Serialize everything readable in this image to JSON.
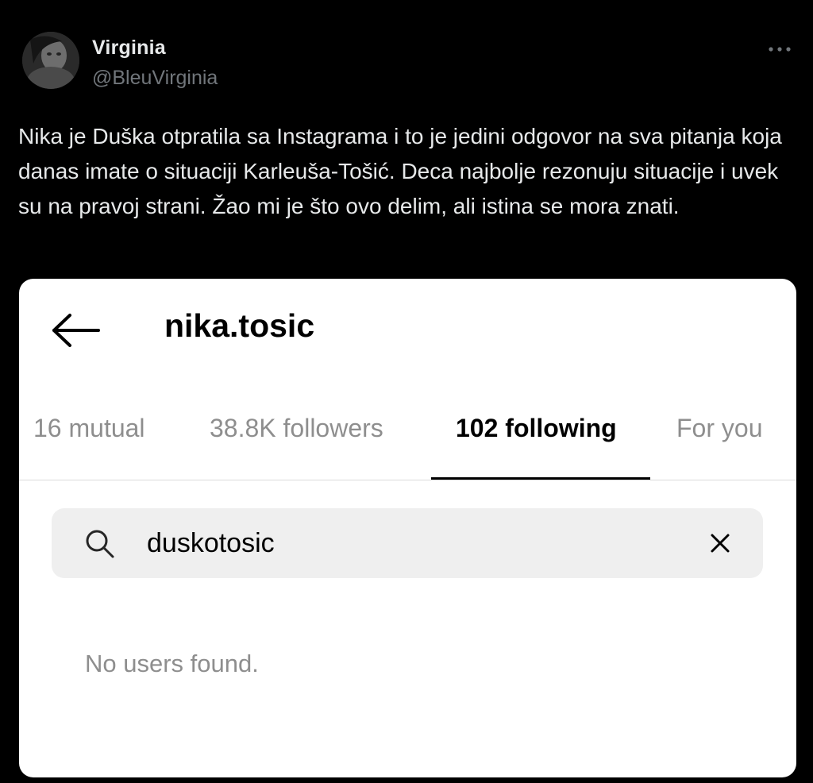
{
  "tweet": {
    "author": {
      "name": "Virginia",
      "handle": "@BleuVirginia"
    },
    "text": "Nika je Duška otpratila sa Instagrama i to je jedini odgovor na sva pitanja koja danas imate o situaciji Karleuša-Tošić. Deca najbolje rezonuju situacije i uvek su na pravoj strani. Žao mi je što ovo delim, ali istina se mora znati."
  },
  "embed": {
    "profile": {
      "username": "nika.tosic"
    },
    "tabs": [
      {
        "label": "16 mutual",
        "active": false
      },
      {
        "label": "38.8K followers",
        "active": false
      },
      {
        "label": "102 following",
        "active": true
      },
      {
        "label": "For you",
        "active": false
      }
    ],
    "search": {
      "value": "duskotosic"
    },
    "empty_message": "No users found."
  },
  "icons": {
    "back": "arrow-left-icon",
    "more": "more-horizontal-icon",
    "search": "search-icon",
    "clear": "close-icon"
  },
  "colors": {
    "background": "#000000",
    "tweet_text": "#e7e9ea",
    "handle": "#71767b",
    "card_background": "#ffffff",
    "tab_inactive": "#8e8e8e",
    "search_background": "#efefef"
  }
}
